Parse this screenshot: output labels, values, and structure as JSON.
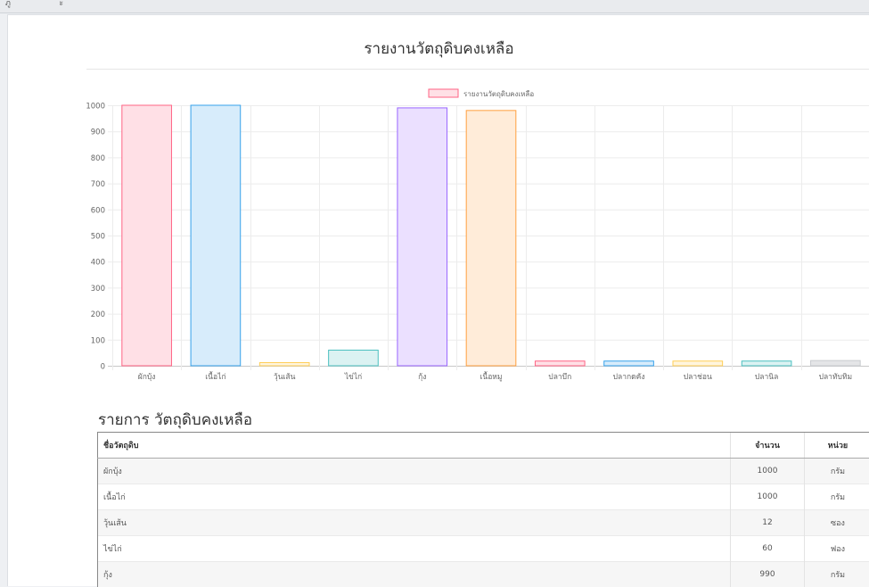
{
  "topbar": {
    "breadcrumb": "ภู                   ะ"
  },
  "page": {
    "title": "รายงานวัตถุดิบคงเหลือ",
    "list_title": "รายการ วัตถุดิบคงเหลือ"
  },
  "chart_data": {
    "type": "bar",
    "title": "",
    "legend": {
      "label": "รายงานวัตถุดิบคงเหลือ",
      "placement": "top-center"
    },
    "categories": [
      "ผักบุ้ง",
      "เนื้อไก่",
      "วุ้นเส้น",
      "ไข่ไก่",
      "กุ้ง",
      "เนื้อหมู",
      "ปลาบึก",
      "ปลากดคัง",
      "ปลาช่อน",
      "ปลานิล",
      "ปลาทับทิม"
    ],
    "values": [
      1000,
      1000,
      12,
      60,
      990,
      980,
      18,
      18,
      18,
      18,
      20
    ],
    "ylim": [
      0,
      1000
    ],
    "yticks": [
      0,
      100,
      200,
      300,
      400,
      500,
      600,
      700,
      800,
      900,
      1000
    ],
    "grid": true,
    "colors": [
      {
        "fill": "#ffe0e6",
        "stroke": "#ff6384"
      },
      {
        "fill": "#d7ecfb",
        "stroke": "#36a2eb"
      },
      {
        "fill": "#fff5dd",
        "stroke": "#ffce56"
      },
      {
        "fill": "#dbf2f2",
        "stroke": "#4bc0c0"
      },
      {
        "fill": "#ebe0ff",
        "stroke": "#9966ff"
      },
      {
        "fill": "#ffecd9",
        "stroke": "#ff9f40"
      },
      {
        "fill": "#ffe0e6",
        "stroke": "#ff6384"
      },
      {
        "fill": "#d7ecfb",
        "stroke": "#36a2eb"
      },
      {
        "fill": "#fff5dd",
        "stroke": "#ffce56"
      },
      {
        "fill": "#dbf2f2",
        "stroke": "#4bc0c0"
      },
      {
        "fill": "#e4e5e7",
        "stroke": "#c9cbcf"
      }
    ]
  },
  "table": {
    "headers": {
      "name": "ชื่อวัตถุดิบ",
      "qty": "จำนวน",
      "unit": "หน่วย"
    },
    "rows": [
      {
        "name": "ผักบุ้ง",
        "qty": "1000",
        "unit": "กรัม"
      },
      {
        "name": "เนื้อไก่",
        "qty": "1000",
        "unit": "กรัม"
      },
      {
        "name": "วุ้นเส้น",
        "qty": "12",
        "unit": "ซอง"
      },
      {
        "name": "ไข่ไก่",
        "qty": "60",
        "unit": "ฟอง"
      },
      {
        "name": "กุ้ง",
        "qty": "990",
        "unit": "กรัม"
      }
    ]
  }
}
